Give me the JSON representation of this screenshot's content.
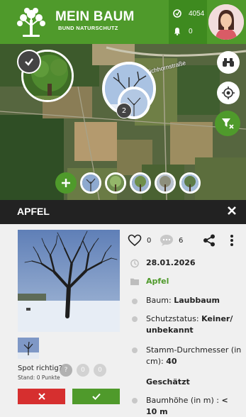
{
  "header": {
    "brand_name": "MEIN BAUM",
    "brand_sub": "BUND NATURSCHUTZ",
    "points_count": "4054",
    "notifications_count": "0",
    "brand_color": "#4f9a2b"
  },
  "map": {
    "street_label": "Eichhornstraße",
    "cluster_count": "2"
  },
  "tree": {
    "title": "APFEL",
    "likes": "0",
    "comments": "6",
    "date": "28.01.2026",
    "category": "Apfel",
    "details": [
      {
        "label": "Baum: ",
        "value": "Laubbaum"
      },
      {
        "label": "Schutzstatus: ",
        "value": "Keiner/ unbekannt"
      },
      {
        "label": "Stamm-Durchmesser (in cm): ",
        "value": "40"
      },
      {
        "label": "",
        "value": "Geschätzt"
      },
      {
        "label": "Baumhöhe (in m) : ",
        "value": "< 10 m"
      }
    ]
  },
  "spot": {
    "question": "Spot richtig?",
    "stand": "Stand: 0 Punkte",
    "dot_labels": [
      "?",
      "0",
      "0"
    ]
  },
  "icons": {
    "logo": "tree-logo-icon",
    "points": "points-icon",
    "bell": "bell-icon",
    "binoculars": "binoculars-icon",
    "locate": "locate-icon",
    "filter": "filter-off-icon",
    "close": "close-icon",
    "heart": "heart-icon",
    "comment": "comment-icon",
    "share": "share-icon",
    "more": "more-vertical-icon",
    "clock": "clock-icon",
    "folder": "folder-icon"
  }
}
